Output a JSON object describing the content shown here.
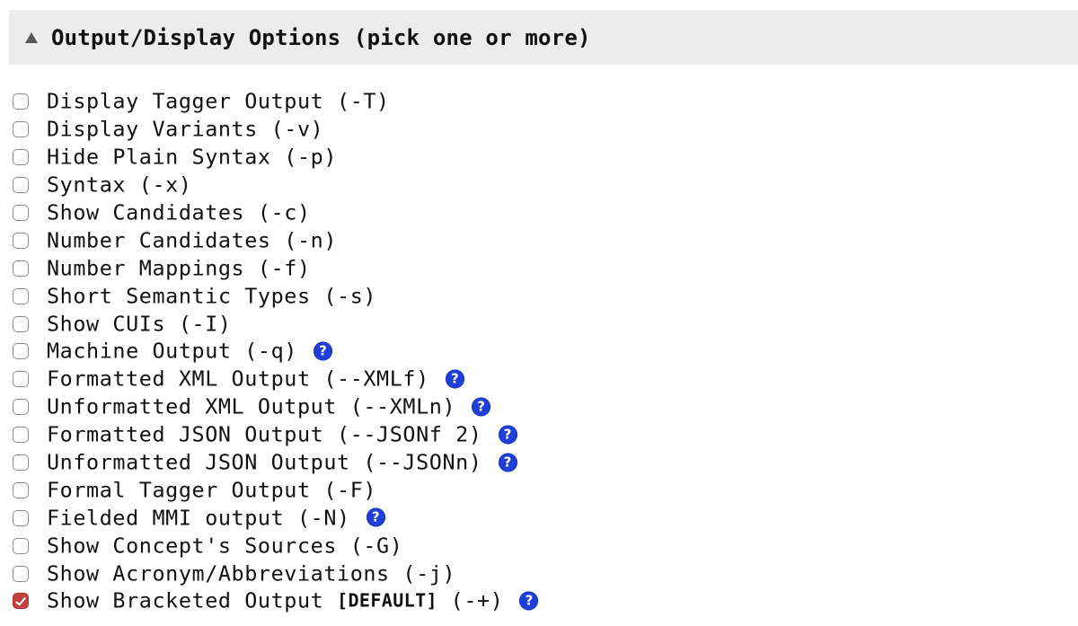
{
  "section": {
    "title": "Output/Display Options (pick one or more)",
    "expanded": true
  },
  "colors": {
    "header_bg": "#ececec",
    "checkbox_checked": "#c2403d",
    "help_icon": "#1f3fd8"
  },
  "options": [
    {
      "label": "Display Tagger Output (-T)",
      "checked": false,
      "help": false
    },
    {
      "label": "Display Variants (-v)",
      "checked": false,
      "help": false
    },
    {
      "label": "Hide Plain Syntax (-p)",
      "checked": false,
      "help": false
    },
    {
      "label": "Syntax (-x)",
      "checked": false,
      "help": false
    },
    {
      "label": "Show Candidates (-c)",
      "checked": false,
      "help": false
    },
    {
      "label": "Number Candidates (-n)",
      "checked": false,
      "help": false
    },
    {
      "label": "Number Mappings (-f)",
      "checked": false,
      "help": false
    },
    {
      "label": "Short Semantic Types (-s)",
      "checked": false,
      "help": false
    },
    {
      "label": "Show CUIs (-I)",
      "checked": false,
      "help": false
    },
    {
      "label": "Machine Output (-q)",
      "checked": false,
      "help": true
    },
    {
      "label": "Formatted XML Output (--XMLf)",
      "checked": false,
      "help": true
    },
    {
      "label": "Unformatted XML Output (--XMLn)",
      "checked": false,
      "help": true
    },
    {
      "label": "Formatted JSON Output (--JSONf 2)",
      "checked": false,
      "help": true
    },
    {
      "label": "Unformatted JSON Output (--JSONn)",
      "checked": false,
      "help": true
    },
    {
      "label": "Formal Tagger Output (-F)",
      "checked": false,
      "help": false
    },
    {
      "label": "Fielded MMI output (-N)",
      "checked": false,
      "help": true
    },
    {
      "label": "Show Concept's Sources (-G)",
      "checked": false,
      "help": false
    },
    {
      "label": "Show Acronym/Abbreviations (-j)",
      "checked": false,
      "help": false
    },
    {
      "label": "Show Bracketed Output ",
      "default_tag": "[DEFAULT]",
      "label_suffix": " (-+)",
      "checked": true,
      "help": true
    }
  ],
  "help_icon_glyph": "?"
}
